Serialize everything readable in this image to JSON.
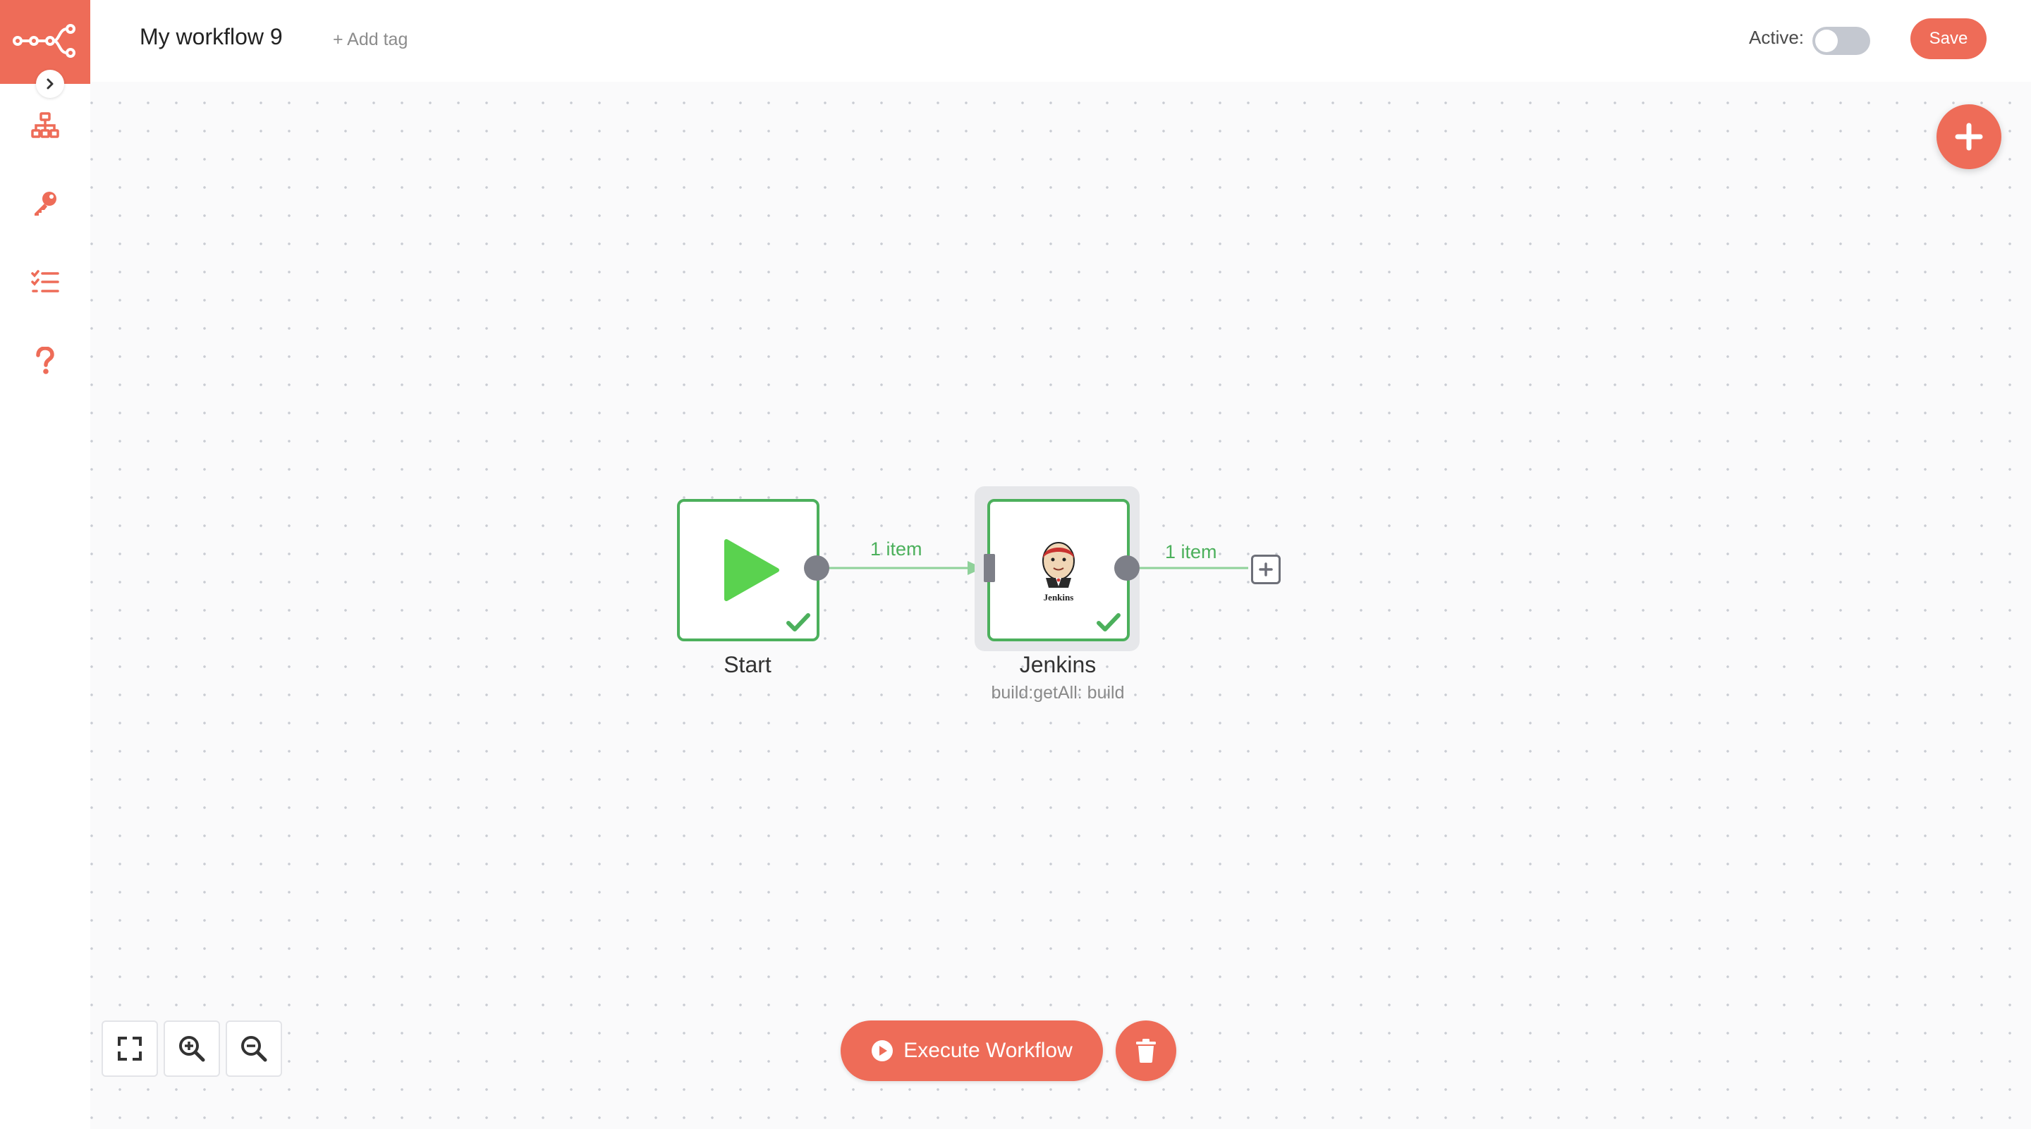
{
  "header": {
    "workflow_name": "My workflow 9",
    "add_tag_label": "+ Add tag",
    "active_label": "Active:",
    "active": false,
    "save_label": "Save"
  },
  "sidebar": {
    "items": [
      {
        "icon": "network-icon",
        "label": "Workflows"
      },
      {
        "icon": "key-icon",
        "label": "Credentials"
      },
      {
        "icon": "tasks-icon",
        "label": "Executions"
      },
      {
        "icon": "question-icon",
        "label": "Help"
      }
    ]
  },
  "nodes": [
    {
      "name": "Start",
      "subtitle": "",
      "status": "success",
      "icon": "play-icon"
    },
    {
      "name": "Jenkins",
      "subtitle": "build:getAll: build",
      "status": "success",
      "icon": "jenkins-icon",
      "icon_text": "Jenkins"
    }
  ],
  "connections": [
    {
      "from": "Start",
      "to": "Jenkins",
      "label": "1 item"
    },
    {
      "from": "Jenkins",
      "to": "",
      "label": "1 item"
    }
  ],
  "controls": {
    "execute_label": "Execute Workflow"
  },
  "colors": {
    "brand": "#ee6c58",
    "success": "#4cb05c",
    "handle": "#7d7f88"
  }
}
